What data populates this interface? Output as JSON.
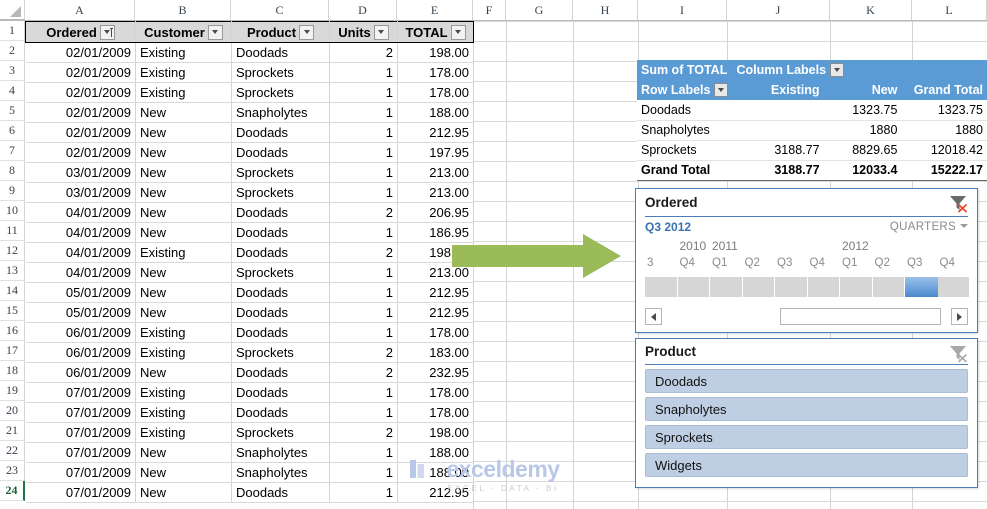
{
  "spreadsheet": {
    "column_headers": [
      "A",
      "B",
      "C",
      "D",
      "E",
      "F",
      "G",
      "H",
      "I",
      "J",
      "K",
      "L"
    ],
    "row_headers": [
      "1",
      "2",
      "3",
      "4",
      "5",
      "6",
      "7",
      "8",
      "9",
      "10",
      "11",
      "12",
      "13",
      "14",
      "15",
      "16",
      "17",
      "18",
      "19",
      "20",
      "21",
      "22",
      "23",
      "24"
    ],
    "active_row": "24"
  },
  "data_table": {
    "headers": [
      "Ordered",
      "Customer",
      "Product",
      "Units",
      "TOTAL"
    ],
    "rows": [
      [
        "02/01/2009",
        "Existing",
        "Doodads",
        "2",
        "198.00"
      ],
      [
        "02/01/2009",
        "Existing",
        "Sprockets",
        "1",
        "178.00"
      ],
      [
        "02/01/2009",
        "Existing",
        "Sprockets",
        "1",
        "178.00"
      ],
      [
        "02/01/2009",
        "New",
        "Snapholytes",
        "1",
        "188.00"
      ],
      [
        "02/01/2009",
        "New",
        "Doodads",
        "1",
        "212.95"
      ],
      [
        "02/01/2009",
        "New",
        "Doodads",
        "1",
        "197.95"
      ],
      [
        "03/01/2009",
        "New",
        "Sprockets",
        "1",
        "213.00"
      ],
      [
        "03/01/2009",
        "New",
        "Sprockets",
        "1",
        "213.00"
      ],
      [
        "04/01/2009",
        "New",
        "Doodads",
        "2",
        "206.95"
      ],
      [
        "04/01/2009",
        "New",
        "Doodads",
        "1",
        "186.95"
      ],
      [
        "04/01/2009",
        "Existing",
        "Doodads",
        "2",
        "198.00"
      ],
      [
        "04/01/2009",
        "New",
        "Sprockets",
        "1",
        "213.00"
      ],
      [
        "05/01/2009",
        "New",
        "Doodads",
        "1",
        "212.95"
      ],
      [
        "05/01/2009",
        "New",
        "Doodads",
        "1",
        "212.95"
      ],
      [
        "06/01/2009",
        "Existing",
        "Doodads",
        "1",
        "178.00"
      ],
      [
        "06/01/2009",
        "Existing",
        "Sprockets",
        "2",
        "183.00"
      ],
      [
        "06/01/2009",
        "New",
        "Doodads",
        "2",
        "232.95"
      ],
      [
        "07/01/2009",
        "Existing",
        "Doodads",
        "1",
        "178.00"
      ],
      [
        "07/01/2009",
        "Existing",
        "Doodads",
        "1",
        "178.00"
      ],
      [
        "07/01/2009",
        "Existing",
        "Sprockets",
        "2",
        "198.00"
      ],
      [
        "07/01/2009",
        "New",
        "Snapholytes",
        "1",
        "188.00"
      ],
      [
        "07/01/2009",
        "New",
        "Snapholytes",
        "1",
        "188.00"
      ],
      [
        "07/01/2009",
        "New",
        "Doodads",
        "1",
        "212.95"
      ]
    ]
  },
  "pivot": {
    "value_field": "Sum of TOTAL",
    "column_labels": "Column Labels",
    "row_labels": "Row Labels",
    "columns": [
      "Existing",
      "New",
      "Grand Total"
    ],
    "rows": [
      {
        "label": "Doodads",
        "existing": "",
        "new": "1323.75",
        "grand_total": "1323.75"
      },
      {
        "label": "Snapholytes",
        "existing": "",
        "new": "1880",
        "grand_total": "1880"
      },
      {
        "label": "Sprockets",
        "existing": "3188.77",
        "new": "8829.65",
        "grand_total": "12018.42"
      }
    ],
    "grand_total": {
      "label": "Grand Total",
      "existing": "3188.77",
      "new": "12033.4",
      "grand_total": "15222.17"
    }
  },
  "timeline": {
    "title": "Ordered",
    "selection": "Q3 2012",
    "level": "QUARTERS",
    "clear_filter_icon": "clear-filter-icon",
    "years": [
      "2010",
      "2011",
      "2012"
    ],
    "quarters": [
      "3",
      "Q4",
      "Q1",
      "Q2",
      "Q3",
      "Q4",
      "Q1",
      "Q2",
      "Q3",
      "Q4"
    ],
    "selected_index": 8,
    "scroll_left_icon": "triangle-left-icon",
    "scroll_right_icon": "triangle-right-icon"
  },
  "slicer": {
    "title": "Product",
    "clear_filter_icon": "clear-filter-icon",
    "items": [
      "Doodads",
      "Snapholytes",
      "Sprockets",
      "Widgets"
    ]
  },
  "annotation": {
    "arrow_icon": "green-right-arrow",
    "arrow_color": "#9bbb59"
  },
  "watermark": {
    "brand": "exceldemy",
    "tagline": "EXCEL - DATA - BI"
  },
  "colors": {
    "pivot_header": "#5b9bd5",
    "slicer_item": "#bfcfe3",
    "slicer_border": "#4a7ebb",
    "timeline_selected": "#4a87cc",
    "table_header": "#d9d9d9"
  }
}
